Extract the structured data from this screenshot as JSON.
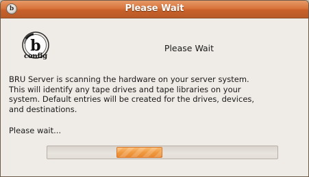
{
  "window": {
    "title": "Please Wait",
    "app_icon": "bru-logo-icon"
  },
  "logo": {
    "letter": "b",
    "word": "config"
  },
  "dialog": {
    "heading": "Please Wait",
    "message_lines": [
      "BRU Server is scanning the hardware on your server system.",
      "This will identify any tape drives and tape libraries on your",
      "system.  Default entries will be created for the drives, devices,",
      "and destinations."
    ],
    "wait_label": "Please wait..."
  },
  "progress": {
    "mode": "indeterminate",
    "indicator_start_fraction": 0.3,
    "indicator_width_fraction": 0.2
  },
  "colors": {
    "titlebar": "#d7743c",
    "progress_fill": "#f09a40",
    "background": "#efebe7"
  }
}
